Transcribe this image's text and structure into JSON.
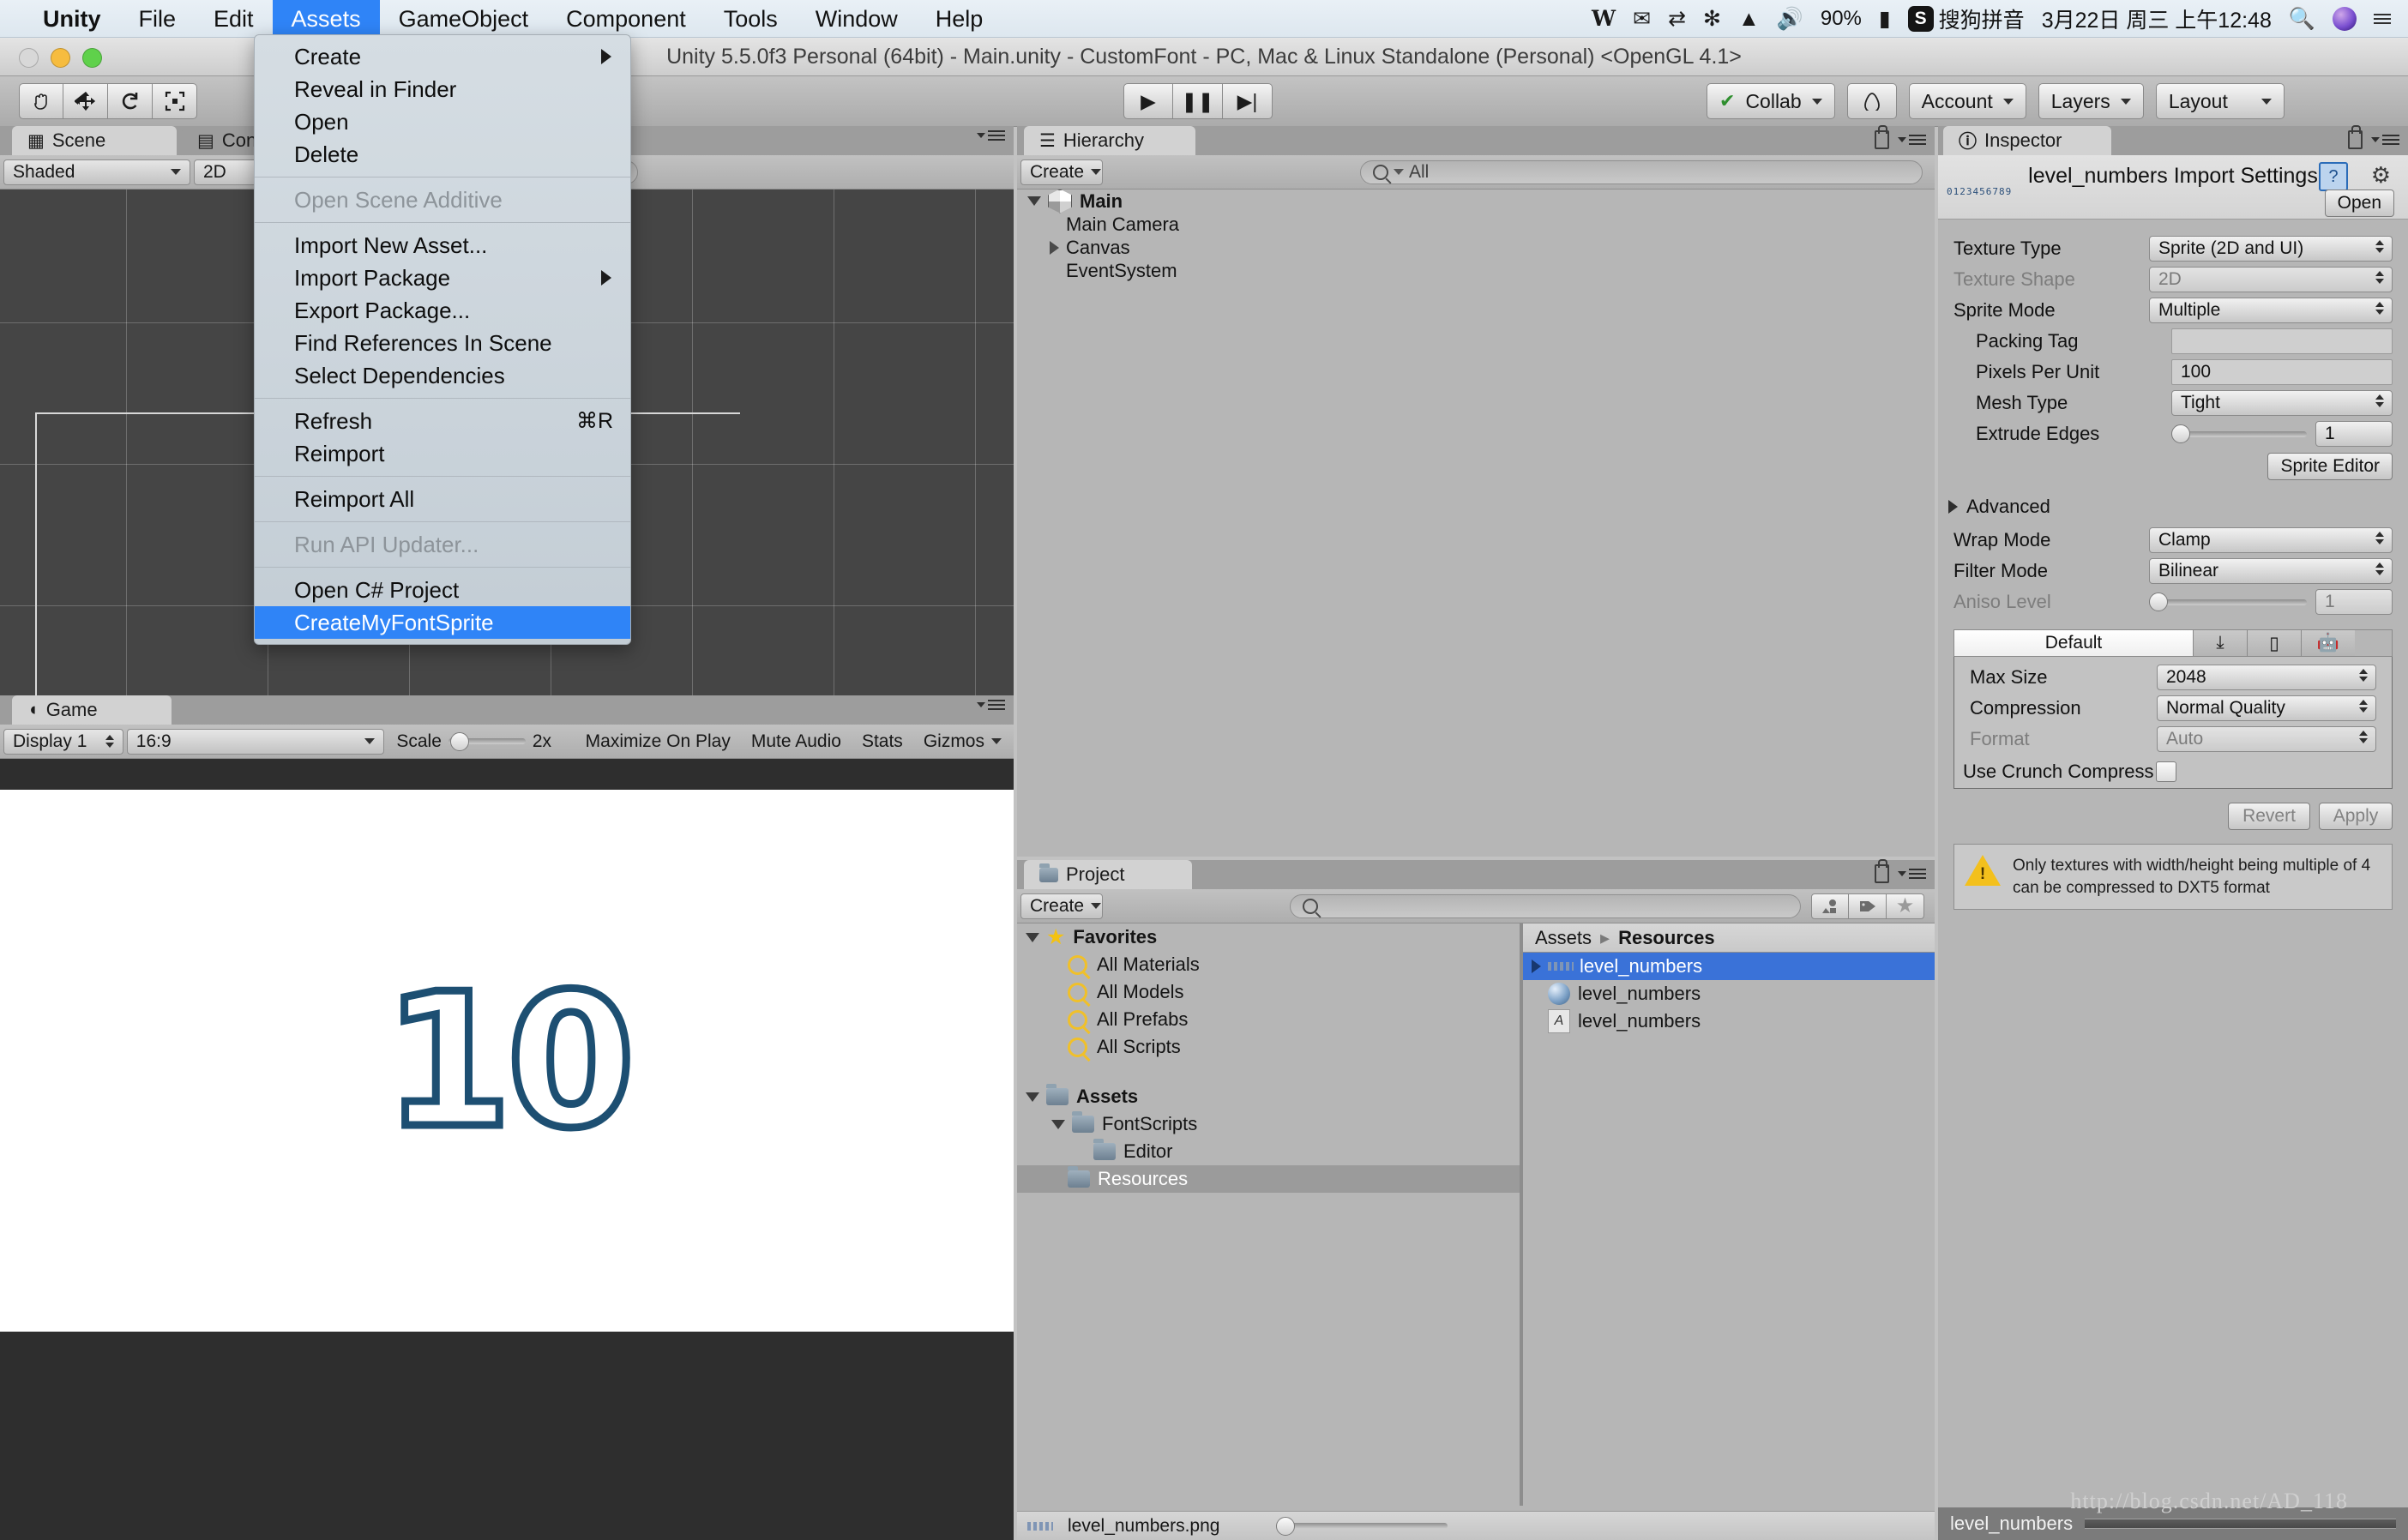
{
  "macbar": {
    "menus": [
      {
        "label": "Unity",
        "bold": true,
        "active": false
      },
      {
        "label": "File",
        "bold": false,
        "active": false
      },
      {
        "label": "Edit",
        "bold": false,
        "active": false
      },
      {
        "label": "Assets",
        "bold": false,
        "active": true
      },
      {
        "label": "GameObject",
        "bold": false,
        "active": false
      },
      {
        "label": "Component",
        "bold": false,
        "active": false
      },
      {
        "label": "Tools",
        "bold": false,
        "active": false
      },
      {
        "label": "Window",
        "bold": false,
        "active": false
      },
      {
        "label": "Help",
        "bold": false,
        "active": false
      }
    ],
    "status": {
      "word_icon": "W",
      "mail_icon": "✉",
      "sync_icon": "⇄",
      "bluetooth_icon": "✻",
      "wifi_icon": "wifi-icon",
      "volume_icon": "🔊",
      "battery_percent": "90%",
      "battery_icon": "battery-icon",
      "ime_badge": "S",
      "ime_label": "搜狗拼音",
      "clock": "3月22日 周三 上午12:48",
      "spotlight_icon": "search-icon",
      "siri_icon": "siri-icon",
      "notification_icon": "list-icon"
    }
  },
  "window": {
    "title": "Unity 5.5.0f3 Personal (64bit) - Main.unity - CustomFont - PC, Mac & Linux Standalone (Personal) <OpenGL 4.1>"
  },
  "toolbar": {
    "tools": [
      "hand-tool",
      "move-tool",
      "rotate-tool",
      "rect-tool"
    ],
    "play": "▶",
    "pause": "❚❚",
    "step": "▶|",
    "collab": "Collab",
    "cloud_icon": "cloud-icon",
    "account": "Account",
    "layers": "Layers",
    "layout": "Layout"
  },
  "assets_menu": {
    "groups": [
      [
        {
          "label": "Create",
          "submenu": true,
          "disabled": false,
          "shortcut": "",
          "highlight": false
        },
        {
          "label": "Reveal in Finder",
          "submenu": false,
          "disabled": false,
          "shortcut": "",
          "highlight": false
        },
        {
          "label": "Open",
          "submenu": false,
          "disabled": false,
          "shortcut": "",
          "highlight": false
        },
        {
          "label": "Delete",
          "submenu": false,
          "disabled": false,
          "shortcut": "",
          "highlight": false
        }
      ],
      [
        {
          "label": "Open Scene Additive",
          "submenu": false,
          "disabled": true,
          "shortcut": "",
          "highlight": false
        }
      ],
      [
        {
          "label": "Import New Asset...",
          "submenu": false,
          "disabled": false,
          "shortcut": "",
          "highlight": false
        },
        {
          "label": "Import Package",
          "submenu": true,
          "disabled": false,
          "shortcut": "",
          "highlight": false
        },
        {
          "label": "Export Package...",
          "submenu": false,
          "disabled": false,
          "shortcut": "",
          "highlight": false
        },
        {
          "label": "Find References In Scene",
          "submenu": false,
          "disabled": false,
          "shortcut": "",
          "highlight": false
        },
        {
          "label": "Select Dependencies",
          "submenu": false,
          "disabled": false,
          "shortcut": "",
          "highlight": false
        }
      ],
      [
        {
          "label": "Refresh",
          "submenu": false,
          "disabled": false,
          "shortcut": "⌘R",
          "highlight": false
        },
        {
          "label": "Reimport",
          "submenu": false,
          "disabled": false,
          "shortcut": "",
          "highlight": false
        }
      ],
      [
        {
          "label": "Reimport All",
          "submenu": false,
          "disabled": false,
          "shortcut": "",
          "highlight": false
        }
      ],
      [
        {
          "label": "Run API Updater...",
          "submenu": false,
          "disabled": true,
          "shortcut": "",
          "highlight": false
        }
      ],
      [
        {
          "label": "Open C# Project",
          "submenu": false,
          "disabled": false,
          "shortcut": "",
          "highlight": false
        },
        {
          "label": "CreateMyFontSprite",
          "submenu": false,
          "disabled": false,
          "shortcut": "",
          "highlight": true
        }
      ]
    ]
  },
  "scene_panel": {
    "tabs": [
      {
        "label": "Scene",
        "icon": "grid-icon",
        "active": true
      },
      {
        "label": "Console",
        "icon": "console-icon",
        "active": false
      }
    ],
    "shading": "Shaded",
    "mode": "2D"
  },
  "game_panel": {
    "tab": "Game",
    "tab_icon": "gamepad-icon",
    "display": "Display 1",
    "aspect": "16:9",
    "scale_label": "Scale",
    "scale_value": "2x",
    "maximize": "Maximize On Play",
    "mute": "Mute Audio",
    "stats": "Stats",
    "gizmos": "Gizmos",
    "number_display": "10",
    "number_color": "#1d4f72"
  },
  "hierarchy": {
    "tab": "Hierarchy",
    "tab_icon": "hierarchy-icon",
    "create": "Create",
    "search_placeholder": "All",
    "search_value": "",
    "items": [
      {
        "label": "Main",
        "depth": 0,
        "arrow": "down",
        "bold": true,
        "scene": true
      },
      {
        "label": "Main Camera",
        "depth": 1,
        "arrow": "none",
        "bold": false,
        "scene": false
      },
      {
        "label": "Canvas",
        "depth": 1,
        "arrow": "right",
        "bold": false,
        "scene": false
      },
      {
        "label": "EventSystem",
        "depth": 1,
        "arrow": "none",
        "bold": false,
        "scene": false
      }
    ]
  },
  "project": {
    "tab": "Project",
    "tab_icon": "folder-icon",
    "create": "Create",
    "search_value": "",
    "tree": [
      {
        "label": "Favorites",
        "type": "star",
        "depth": 0,
        "arrow": "down",
        "bold": true,
        "selected": false
      },
      {
        "label": "All Materials",
        "type": "search",
        "depth": 1,
        "arrow": "none",
        "bold": false,
        "selected": false
      },
      {
        "label": "All Models",
        "type": "search",
        "depth": 1,
        "arrow": "none",
        "bold": false,
        "selected": false
      },
      {
        "label": "All Prefabs",
        "type": "search",
        "depth": 1,
        "arrow": "none",
        "bold": false,
        "selected": false
      },
      {
        "label": "All Scripts",
        "type": "search",
        "depth": 1,
        "arrow": "none",
        "bold": false,
        "selected": false
      },
      {
        "label": "Assets",
        "type": "folder",
        "depth": 0,
        "arrow": "down",
        "bold": true,
        "selected": false
      },
      {
        "label": "FontScripts",
        "type": "folder",
        "depth": 1,
        "arrow": "down",
        "bold": false,
        "selected": false
      },
      {
        "label": "Editor",
        "type": "folder",
        "depth": 2,
        "arrow": "none",
        "bold": false,
        "selected": false
      },
      {
        "label": "Resources",
        "type": "folder",
        "depth": 1,
        "arrow": "none",
        "bold": false,
        "selected": true
      }
    ],
    "breadcrumb": [
      {
        "label": "Assets",
        "bold": false
      },
      {
        "label": "Resources",
        "bold": true
      }
    ],
    "assets": [
      {
        "label": "level_numbers",
        "icon": "sprite-sheet-icon",
        "arrow": true,
        "selected": true
      },
      {
        "label": "level_numbers",
        "icon": "material-icon",
        "arrow": false,
        "selected": false
      },
      {
        "label": "level_numbers",
        "icon": "font-icon",
        "arrow": false,
        "selected": false
      }
    ],
    "status_file": "level_numbers.png"
  },
  "inspector": {
    "tab": "Inspector",
    "tab_icon": "info-icon",
    "title": "level_numbers Import Settings",
    "thumb_text": "0123456789",
    "open_button": "Open",
    "help_icon": "help-icon",
    "gear_icon": "gear-icon",
    "rows": [
      {
        "label": "Texture Type",
        "value": "Sprite (2D and UI)",
        "kind": "popup",
        "dim": false,
        "indent": false
      },
      {
        "label": "Texture Shape",
        "value": "2D",
        "kind": "popup",
        "dim": true,
        "indent": false
      },
      {
        "label": "Sprite Mode",
        "value": "Multiple",
        "kind": "popup",
        "dim": false,
        "indent": false
      },
      {
        "label": "Packing Tag",
        "value": "",
        "kind": "text",
        "dim": false,
        "indent": true
      },
      {
        "label": "Pixels Per Unit",
        "value": "100",
        "kind": "text",
        "dim": false,
        "indent": true
      },
      {
        "label": "Mesh Type",
        "value": "Tight",
        "kind": "popup",
        "dim": false,
        "indent": true
      },
      {
        "label": "Extrude Edges",
        "value": "1",
        "kind": "slider",
        "dim": false,
        "indent": true
      }
    ],
    "sprite_editor_button": "Sprite Editor",
    "advanced": "Advanced",
    "rows2": [
      {
        "label": "Wrap Mode",
        "value": "Clamp",
        "kind": "popup",
        "dim": false,
        "indent": false
      },
      {
        "label": "Filter Mode",
        "value": "Bilinear",
        "kind": "popup",
        "dim": false,
        "indent": false
      },
      {
        "label": "Aniso Level",
        "value": "1",
        "kind": "slider",
        "dim": true,
        "indent": false
      }
    ],
    "platforms": [
      {
        "label": "Default",
        "icon": "",
        "active": true
      },
      {
        "label": "",
        "icon": "standalone-icon",
        "active": false
      },
      {
        "label": "",
        "icon": "ios-icon",
        "active": false
      },
      {
        "label": "",
        "icon": "android-icon",
        "active": false
      }
    ],
    "rows3": [
      {
        "label": "Max Size",
        "value": "2048",
        "kind": "popup",
        "dim": false,
        "indent": false
      },
      {
        "label": "Compression",
        "value": "Normal Quality",
        "kind": "popup",
        "dim": false,
        "indent": false
      },
      {
        "label": "Format",
        "value": "Auto",
        "kind": "popup",
        "dim": true,
        "indent": false
      }
    ],
    "crunch_label": "Use Crunch Compress",
    "crunch_checked": false,
    "revert": "Revert",
    "apply": "Apply",
    "warning": "Only textures with width/height being multiple of 4 can be compressed to DXT5 format",
    "preview_title": "level_numbers"
  },
  "watermark": "http://blog.csdn.net/AD_118"
}
